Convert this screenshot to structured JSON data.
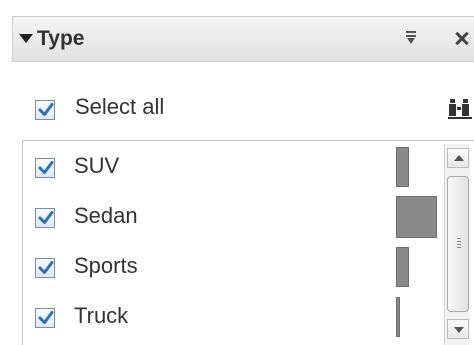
{
  "panel": {
    "title": "Type",
    "icons": {
      "collapse": "collapse-arrow-icon",
      "menu": "panel-menu-icon",
      "close": "close-icon",
      "search": "binoculars-icon"
    }
  },
  "select_all": {
    "label": "Select all",
    "checked": true
  },
  "items": [
    {
      "label": "SUV",
      "checked": true,
      "relative_share": 0.28
    },
    {
      "label": "Sedan",
      "checked": true,
      "relative_share": 1.0
    },
    {
      "label": "Sports",
      "checked": true,
      "relative_share": 0.28
    },
    {
      "label": "Truck",
      "checked": true,
      "relative_share": 0.08
    }
  ],
  "colors": {
    "check": "#2f6fb7",
    "bar": "#8a8a8a",
    "header_bg": "#e6e6e6"
  }
}
